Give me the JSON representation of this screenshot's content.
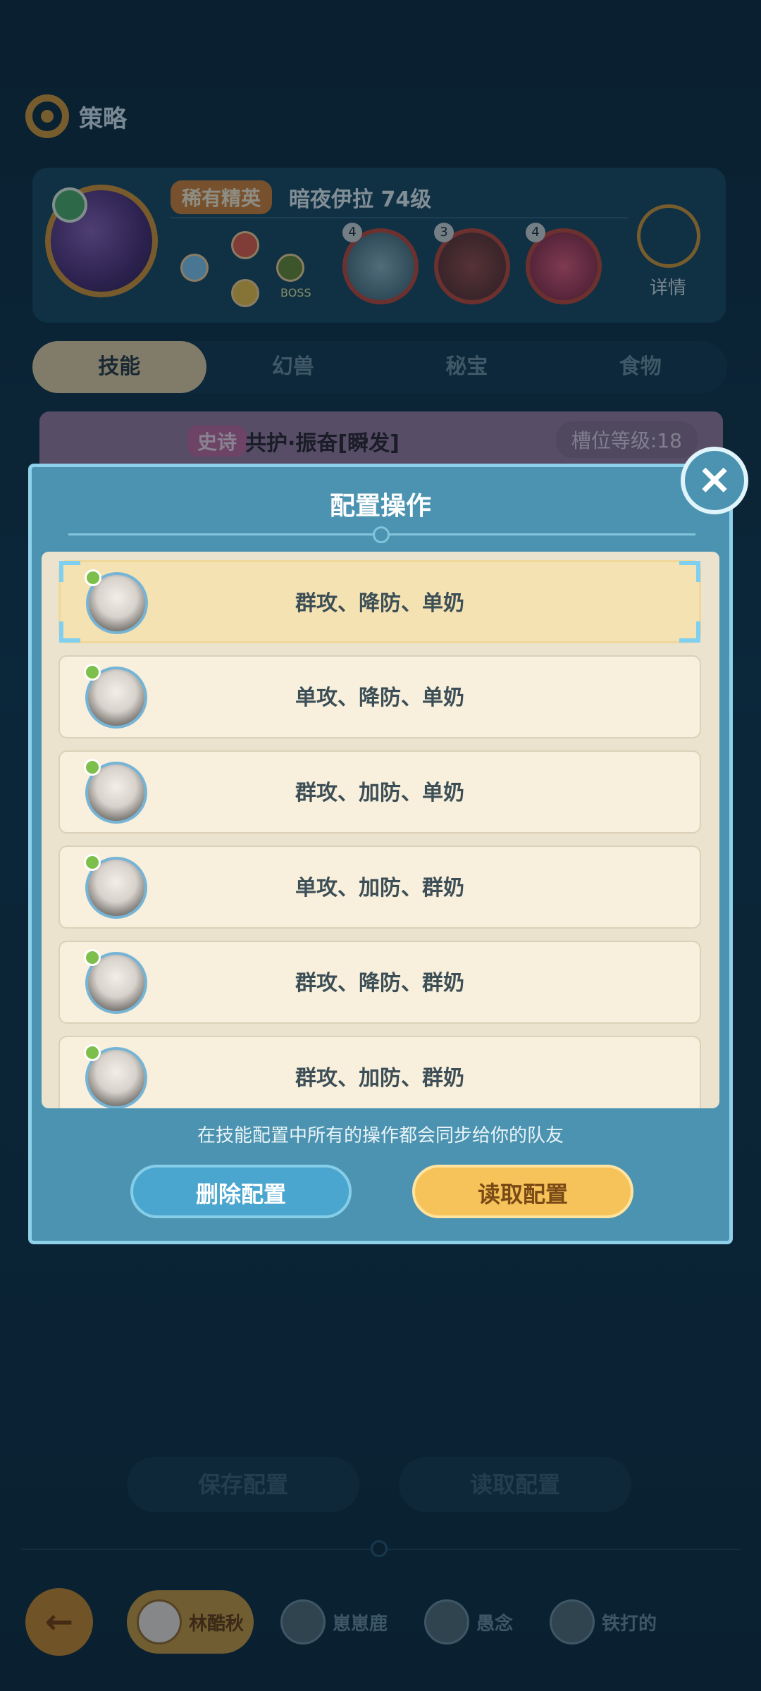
{
  "header": {
    "title": "策略"
  },
  "enemy": {
    "rank_badge": "稀有精英",
    "name_level": "暗夜伊拉 74级",
    "boss_label": "BOSS",
    "skills": [
      {
        "level": "4"
      },
      {
        "level": "3"
      },
      {
        "level": "4"
      }
    ],
    "detail_label": "详情"
  },
  "tabs": [
    {
      "label": "技能",
      "active": true
    },
    {
      "label": "幻兽",
      "active": false
    },
    {
      "label": "秘宝",
      "active": false
    },
    {
      "label": "食物",
      "active": false
    }
  ],
  "background_skill": {
    "tag": "史诗",
    "name": "共护·振奋[瞬发]",
    "slot": "槽位等级:18"
  },
  "modal": {
    "title": "配置操作",
    "rows": [
      {
        "label": "群攻、降防、单奶",
        "selected": true
      },
      {
        "label": "单攻、降防、单奶",
        "selected": false
      },
      {
        "label": "群攻、加防、单奶",
        "selected": false
      },
      {
        "label": "单攻、加防、群奶",
        "selected": false
      },
      {
        "label": "群攻、降防、群奶",
        "selected": false
      },
      {
        "label": "群攻、加防、群奶",
        "selected": false
      }
    ],
    "note": "在技能配置中所有的操作都会同步给你的队友",
    "delete_label": "删除配置",
    "load_label": "读取配置"
  },
  "bottom": {
    "save_label": "保存配置",
    "read_label": "读取配置",
    "back_icon": "←"
  },
  "team": [
    {
      "name": "林酷秋",
      "active": true
    },
    {
      "name": "崽崽鹿",
      "active": false
    },
    {
      "name": "愚念",
      "active": false
    },
    {
      "name": "铁打的",
      "active": false
    }
  ]
}
